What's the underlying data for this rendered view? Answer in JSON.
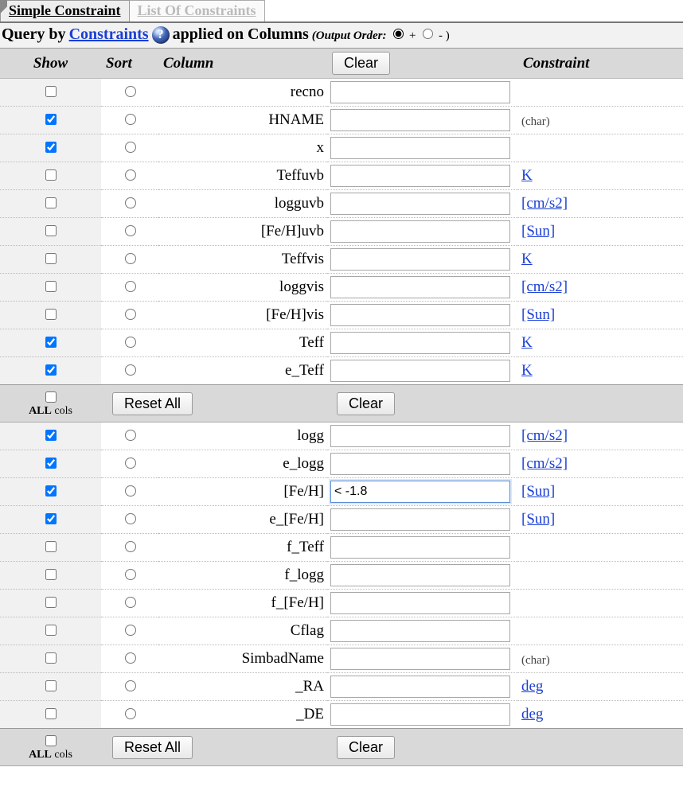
{
  "tabs": {
    "active": "Simple Constraint",
    "inactive": "List Of Constraints"
  },
  "header": {
    "query_by": "Query by ",
    "constraints_link": "Constraints",
    "applied_on": " applied on Columns ",
    "order_prefix": "(Output Order: ",
    "plus": " + ",
    "minus": " - )",
    "help_text": "?"
  },
  "thead": {
    "show": "Show",
    "sort": "Sort",
    "column": "Column",
    "clear": "Clear",
    "constraint": "Constraint"
  },
  "buttons": {
    "reset_all": "Reset All",
    "clear": "Clear",
    "all_cols_html_1": "ALL",
    "all_cols_html_2": " cols"
  },
  "rows": [
    {
      "show": false,
      "name": "recno",
      "value": "",
      "unit": null,
      "unit_is_link": false,
      "char": false
    },
    {
      "show": true,
      "name": "HNAME",
      "value": "",
      "unit": "(char)",
      "unit_is_link": false,
      "char": true
    },
    {
      "show": true,
      "name": "x",
      "value": "",
      "unit": null,
      "unit_is_link": false,
      "char": false
    },
    {
      "show": false,
      "name": "Teffuvb",
      "value": "",
      "unit": "K",
      "unit_is_link": true,
      "char": false
    },
    {
      "show": false,
      "name": "logguvb",
      "value": "",
      "unit": "[cm/s2]",
      "unit_is_link": true,
      "char": false
    },
    {
      "show": false,
      "name": "[Fe/H]uvb",
      "value": "",
      "unit": "[Sun]",
      "unit_is_link": true,
      "char": false
    },
    {
      "show": false,
      "name": "Teffvis",
      "value": "",
      "unit": "K",
      "unit_is_link": true,
      "char": false
    },
    {
      "show": false,
      "name": "loggvis",
      "value": "",
      "unit": "[cm/s2]",
      "unit_is_link": true,
      "char": false
    },
    {
      "show": false,
      "name": "[Fe/H]vis",
      "value": "",
      "unit": "[Sun]",
      "unit_is_link": true,
      "char": false
    },
    {
      "show": true,
      "name": "Teff",
      "value": "",
      "unit": "K",
      "unit_is_link": true,
      "char": false
    },
    {
      "show": true,
      "name": "e_Teff",
      "value": "",
      "unit": "K",
      "unit_is_link": true,
      "char": false
    }
  ],
  "rows2": [
    {
      "show": true,
      "name": "logg",
      "value": "",
      "unit": "[cm/s2]",
      "unit_is_link": true,
      "char": false
    },
    {
      "show": true,
      "name": "e_logg",
      "value": "",
      "unit": "[cm/s2]",
      "unit_is_link": true,
      "char": false
    },
    {
      "show": true,
      "name": "[Fe/H]",
      "value": "< -1.8",
      "unit": "[Sun]",
      "unit_is_link": true,
      "char": false,
      "focused": true
    },
    {
      "show": true,
      "name": "e_[Fe/H]",
      "value": "",
      "unit": "[Sun]",
      "unit_is_link": true,
      "char": false
    },
    {
      "show": false,
      "name": "f_Teff",
      "value": "",
      "unit": null,
      "unit_is_link": false,
      "char": false
    },
    {
      "show": false,
      "name": "f_logg",
      "value": "",
      "unit": null,
      "unit_is_link": false,
      "char": false
    },
    {
      "show": false,
      "name": "f_[Fe/H]",
      "value": "",
      "unit": null,
      "unit_is_link": false,
      "char": false
    },
    {
      "show": false,
      "name": "Cflag",
      "value": "",
      "unit": null,
      "unit_is_link": false,
      "char": false
    },
    {
      "show": false,
      "name": "SimbadName",
      "value": "",
      "unit": "(char)",
      "unit_is_link": false,
      "char": true
    },
    {
      "show": false,
      "name": "_RA",
      "value": "",
      "unit": "deg",
      "unit_is_link": true,
      "char": false
    },
    {
      "show": false,
      "name": "_DE",
      "value": "",
      "unit": "deg",
      "unit_is_link": true,
      "char": false
    }
  ]
}
